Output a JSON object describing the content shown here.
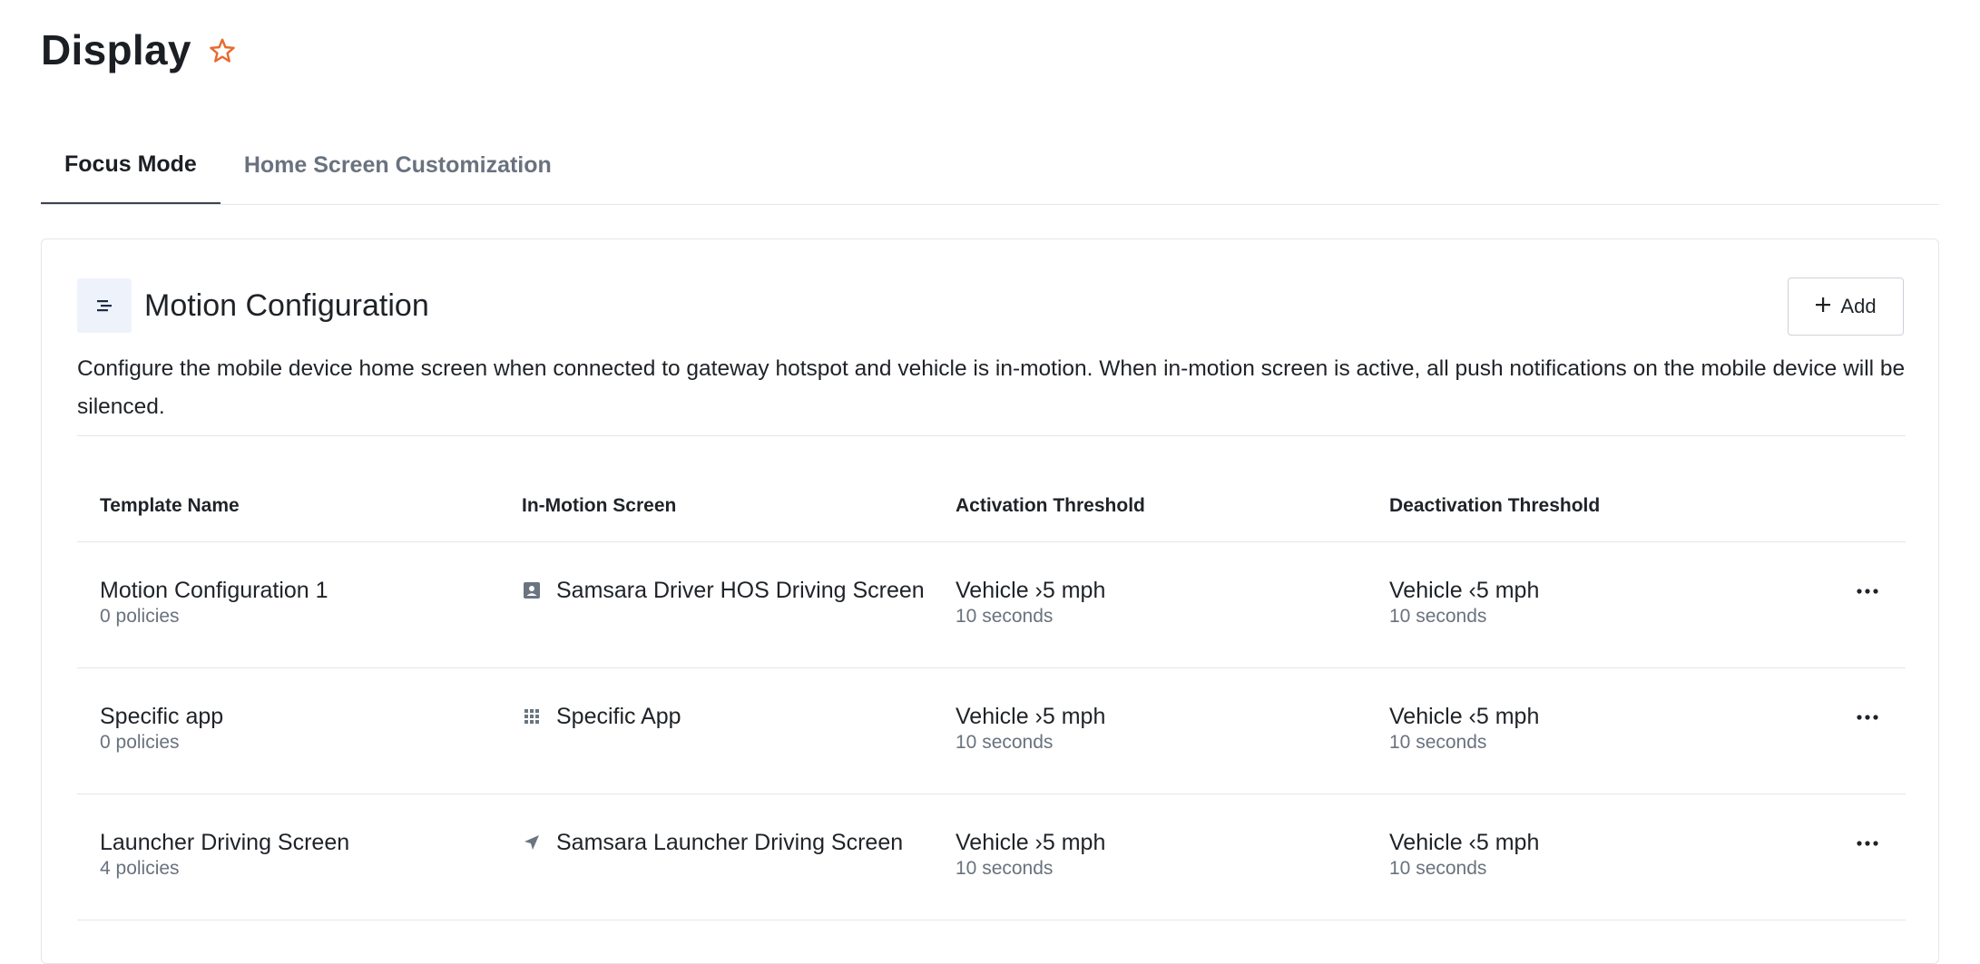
{
  "page": {
    "title": "Display",
    "favorite_icon": "star-icon",
    "accent_color": "#e8692c"
  },
  "tabs": [
    {
      "label": "Focus Mode",
      "active": true
    },
    {
      "label": "Home Screen Customization",
      "active": false
    }
  ],
  "card": {
    "icon": "align-lines-icon",
    "title": "Motion Configuration",
    "add_label": "Add",
    "description": "Configure the mobile device home screen when connected to gateway hotspot and vehicle is in-motion. When in-motion screen is active, all push notifications on the mobile device will be silenced."
  },
  "table": {
    "columns": [
      "Template Name",
      "In-Motion Screen",
      "Activation Threshold",
      "Deactivation Threshold"
    ],
    "rows": [
      {
        "name": "Motion Configuration 1",
        "policies": "0 policies",
        "screen_icon": "contact-badge-icon",
        "screen": "Samsara Driver HOS Driving Screen",
        "activation": "Vehicle ›5 mph",
        "activation_time": "10 seconds",
        "deactivation": "Vehicle ‹5 mph",
        "deactivation_time": "10 seconds"
      },
      {
        "name": "Specific app",
        "policies": "0 policies",
        "screen_icon": "app-grid-icon",
        "screen": "Specific App",
        "activation": "Vehicle ›5 mph",
        "activation_time": "10 seconds",
        "deactivation": "Vehicle ‹5 mph",
        "deactivation_time": "10 seconds"
      },
      {
        "name": "Launcher Driving Screen",
        "policies": "4 policies",
        "screen_icon": "navigation-arrow-icon",
        "screen": "Samsara Launcher Driving Screen",
        "activation": "Vehicle ›5 mph",
        "activation_time": "10 seconds",
        "deactivation": "Vehicle ‹5 mph",
        "deactivation_time": "10 seconds"
      }
    ]
  }
}
